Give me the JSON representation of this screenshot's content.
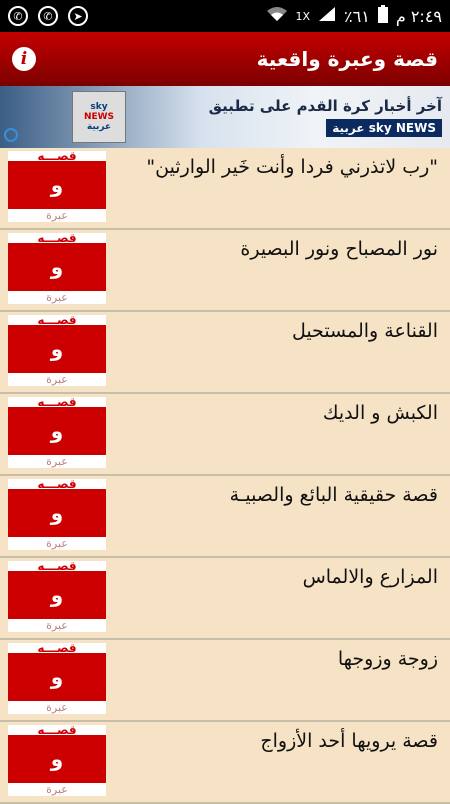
{
  "status_bar": {
    "time": "٢:٤٩ م",
    "battery": "٪٦١",
    "network": "1X",
    "icons_left": [
      "whatsapp-icon",
      "whatsapp-icon",
      "telegram-icon"
    ]
  },
  "app_bar": {
    "title": "قصة وعبرة واقعية",
    "info_label": "i"
  },
  "banner": {
    "line1": "آخر أخبار كرة القدم على تطبيق",
    "line2": "sky NEWS عربية",
    "logo_top": "sky",
    "logo_mid": "NEWS",
    "logo_bottom": "عربية"
  },
  "thumbnail": {
    "top": "قصـــه",
    "mid": "و",
    "bottom": "عبرة"
  },
  "stories": [
    "\"رب لاتذرني فردا وأنت خَير الوارثين\"",
    "نور المصباح ونور البصيرة",
    "القناعة والمستحيل",
    "الكبش و الديك",
    "قصة حقيقية البائع والصبيـة",
    "المزارع والالماس",
    "زوجة وزوجها",
    "قصة يرويها أحد الأزواج"
  ],
  "colors": {
    "accent": "#c40000",
    "background": "#f6e3c5"
  }
}
